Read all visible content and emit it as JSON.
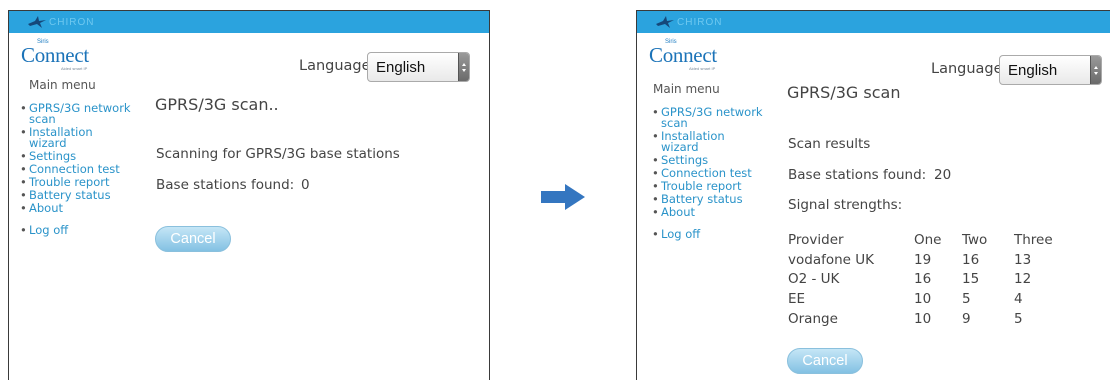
{
  "colors": {
    "header_bar": "#2ba3de",
    "link": "#2a93c9",
    "arrow": "#3476c0",
    "cancel_button": "#9ed1ec"
  },
  "brand": {
    "name": "CHIRON",
    "icon": "bird-logo-icon"
  },
  "logo": {
    "main": "Connect",
    "sup": "Siris",
    "tagline": "Aided smart IP"
  },
  "left": {
    "language": {
      "label": "Language:",
      "value": "English"
    },
    "menu": {
      "title": "Main menu",
      "items": [
        {
          "label": "GPRS/3G network scan"
        },
        {
          "label": "Installation wizard"
        },
        {
          "label": "Settings"
        },
        {
          "label": "Connection test"
        },
        {
          "label": "Trouble report"
        },
        {
          "label": "Battery status"
        },
        {
          "label": "About"
        }
      ],
      "logoff": "Log off"
    },
    "content": {
      "title": "GPRS/3G scan..",
      "status": "Scanning for GPRS/3G base stations",
      "found_label": "Base stations found:",
      "found_value": "0",
      "cancel": "Cancel"
    }
  },
  "transition_icon": "right-arrow-icon",
  "right": {
    "language": {
      "label": "Language:",
      "value": "English"
    },
    "menu": {
      "title": "Main menu",
      "items": [
        {
          "label": "GPRS/3G network scan"
        },
        {
          "label": "Installation wizard"
        },
        {
          "label": "Settings"
        },
        {
          "label": "Connection test"
        },
        {
          "label": "Trouble report"
        },
        {
          "label": "Battery status"
        },
        {
          "label": "About"
        }
      ],
      "logoff": "Log off"
    },
    "content": {
      "title": "GPRS/3G scan",
      "results_heading": "Scan results",
      "found_label": "Base stations found:",
      "found_value": "20",
      "signal_label": "Signal strengths:",
      "table": {
        "headers": [
          "Provider",
          "One",
          "Two",
          "Three"
        ],
        "rows": [
          [
            "vodafone UK",
            "19",
            "16",
            "13"
          ],
          [
            "O2 - UK",
            "16",
            "15",
            "12"
          ],
          [
            "EE",
            "10",
            "5",
            "4"
          ],
          [
            "Orange",
            "10",
            "9",
            "5"
          ]
        ]
      },
      "cancel": "Cancel"
    }
  }
}
